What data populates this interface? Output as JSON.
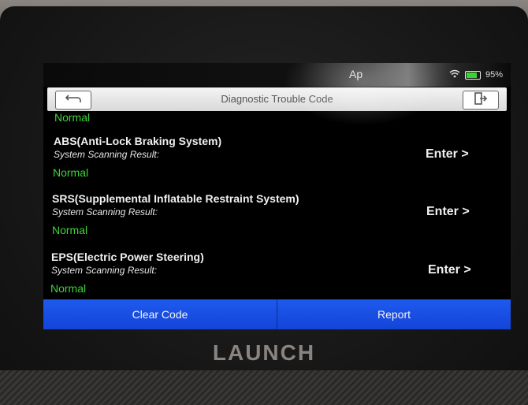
{
  "status_bar": {
    "app_fragment": "Ap",
    "battery": "95%"
  },
  "header": {
    "title": "Diagnostic Trouble Code"
  },
  "list": {
    "top_status": "Normal",
    "items": [
      {
        "name": "ABS(Anti-Lock Braking System)",
        "subtitle": "System Scanning Result:",
        "status": "Normal",
        "enter_label": "Enter >"
      },
      {
        "name": "SRS(Supplemental Inflatable Restraint System)",
        "subtitle": "System Scanning Result:",
        "status": "Normal",
        "enter_label": "Enter >"
      },
      {
        "name": "EPS(Electric Power Steering)",
        "subtitle": "System Scanning Result:",
        "status": "Normal",
        "enter_label": "Enter >"
      }
    ]
  },
  "bottom_bar": {
    "clear_code_label": "Clear Code",
    "report_label": "Report"
  },
  "device": {
    "brand": "LAUNCH"
  },
  "colors": {
    "normal_status": "#3fd33a",
    "button_bar": "#1e5aee"
  },
  "icons": {
    "back": "back-arrow-icon",
    "exit": "exit-icon",
    "wifi": "wifi-icon",
    "battery": "battery-icon"
  }
}
